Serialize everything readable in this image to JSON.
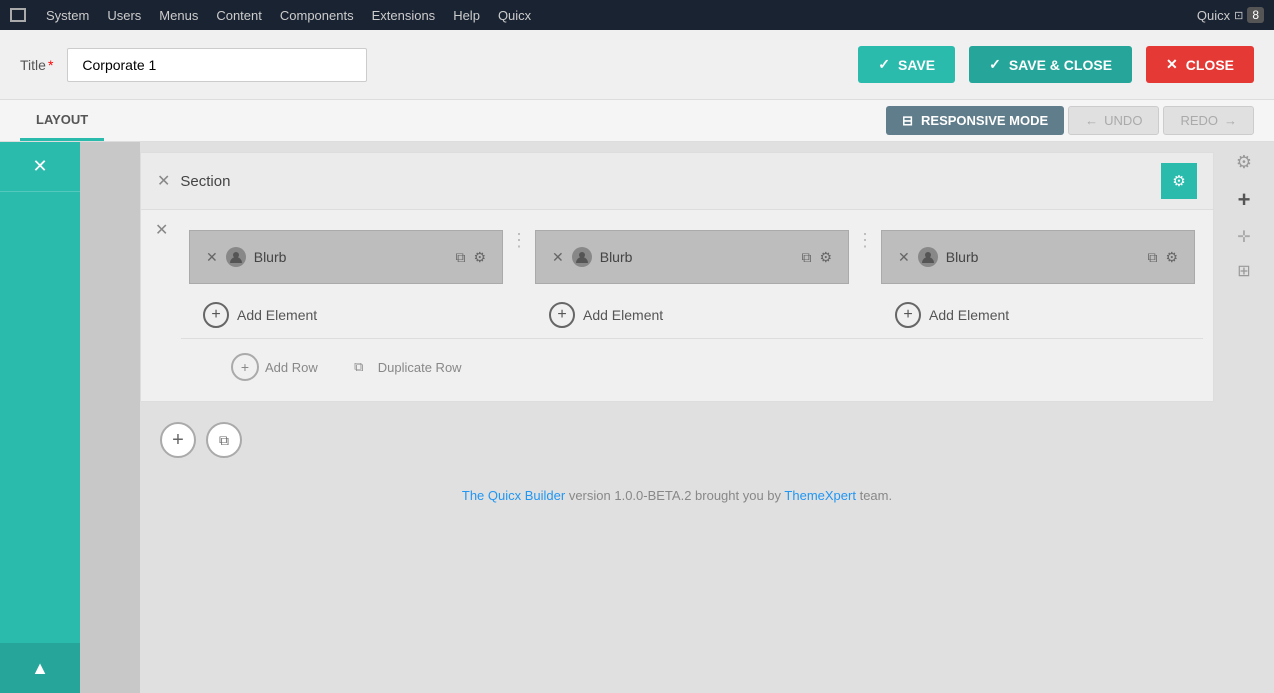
{
  "menubar": {
    "items": [
      "System",
      "Users",
      "Menus",
      "Content",
      "Components",
      "Extensions",
      "Help",
      "Quicx"
    ],
    "app_label": "Quicx",
    "badge": "8"
  },
  "toolbar": {
    "title_label": "Title",
    "title_required": "*",
    "title_value": "Corporate 1",
    "save_label": "SAVE",
    "save_close_label": "SAVE & CLOSE",
    "close_label": "CLOSE"
  },
  "layout_bar": {
    "tab_label": "LAYOUT",
    "responsive_label": "RESPONSIVE MODE",
    "undo_label": "UNDO",
    "redo_label": "REDO"
  },
  "section": {
    "label": "Section",
    "columns": [
      {
        "element": "Blurb",
        "add_element": "Add Element"
      },
      {
        "element": "Blurb",
        "add_element": "Add Element"
      },
      {
        "element": "Blurb",
        "add_element": "Add Element"
      }
    ],
    "add_row": "Add Row",
    "duplicate_row": "Duplicate Row"
  },
  "below": {
    "add_section_plus": "+",
    "duplicate_icon": "⧉"
  },
  "footer": {
    "builder_link_text": "The Quicx Builder",
    "version_text": " version 1.0.0-BETA.2 brought you by ",
    "theme_link_text": "ThemeXpert",
    "team_text": " team."
  },
  "colors": {
    "teal": "#2bbbad",
    "dark_teal": "#26a69a",
    "red": "#e53935",
    "dark_nav": "#1a2332",
    "blue_link": "#2196f3"
  }
}
